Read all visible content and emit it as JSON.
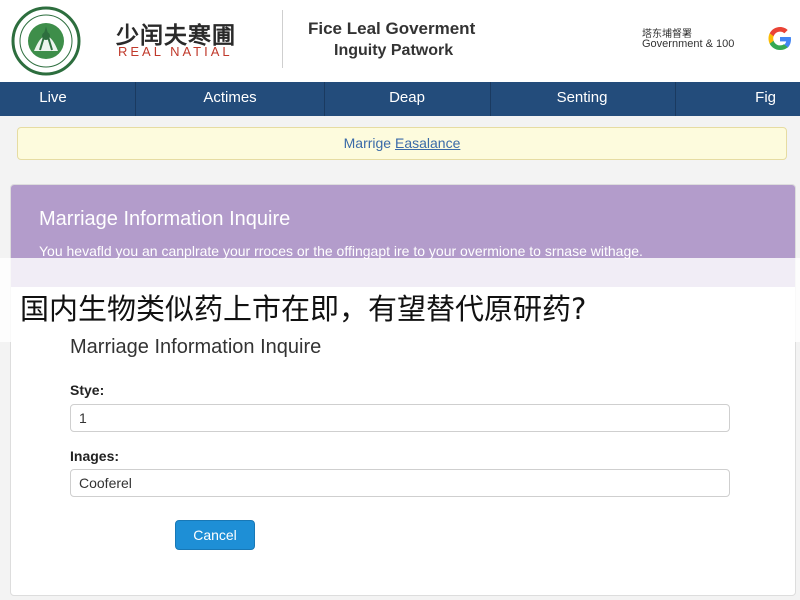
{
  "header": {
    "brand_cn": "少闰夫寒圃",
    "brand_en": "REAL NATIAL",
    "site_title_line1": "Fice Leal Goverment",
    "site_title_line2": "Inguity Patwork",
    "right_cn": "塔东埔督署",
    "right_en": "Government & 100"
  },
  "nav": {
    "items": [
      {
        "label": "Live"
      },
      {
        "label": "Actimes"
      },
      {
        "label": "Deap"
      },
      {
        "label": "Senting"
      },
      {
        "label": "Fig"
      }
    ]
  },
  "notice": {
    "prefix": "Marrige ",
    "link": "Easalance"
  },
  "card": {
    "header_title": "Marriage Information Inquire",
    "header_desc": "You hevafld you an canplrate your rroces or the offingapt ire to your overmione to srnase withage."
  },
  "banner": {
    "text": "国内生物类似药上市在即，有望替代原研药?"
  },
  "form": {
    "title": "Marriage Information Inquire",
    "style_label": "Stye:",
    "style_value": "1",
    "images_label": "Inages:",
    "images_value": "Cooferel",
    "cancel_label": "Cancel"
  },
  "colors": {
    "nav_bg": "#234c7b",
    "card_header_bg": "#b39ccb",
    "notice_bg": "#fdfbdd",
    "button_bg": "#1e8fd6"
  },
  "icons": {
    "emblem": "government-emblem-icon",
    "right_logo": "google-g-icon"
  }
}
